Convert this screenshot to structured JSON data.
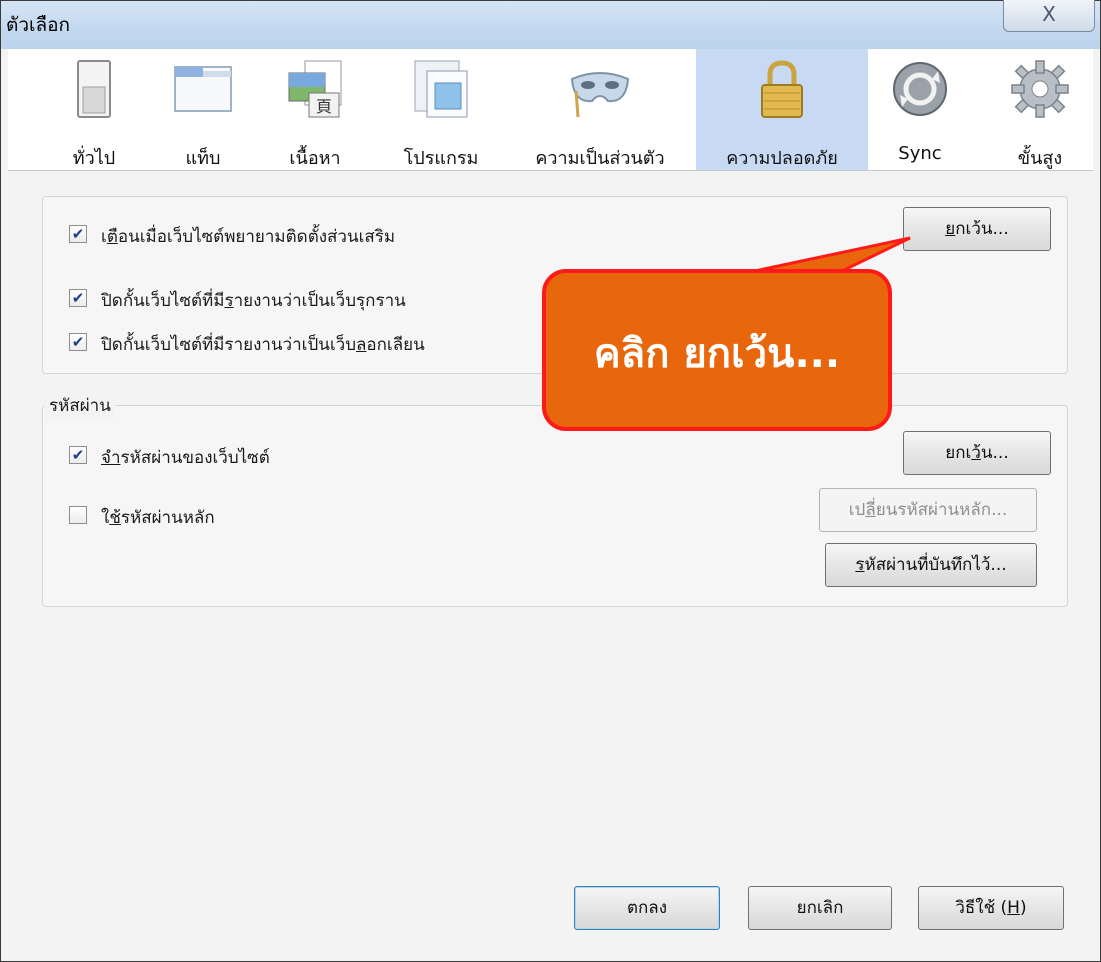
{
  "window": {
    "title": "ตัวเลือก",
    "close_glyph": "X"
  },
  "tabs": [
    {
      "label": "ทั่วไป",
      "icon": "switch-icon"
    },
    {
      "label": "แท็บ",
      "icon": "tab-window-icon"
    },
    {
      "label": "เนื้อหา",
      "icon": "content-image-icon"
    },
    {
      "label": "โปรแกรม",
      "icon": "applications-icon"
    },
    {
      "label": "ความเป็นส่วนตัว",
      "icon": "privacy-mask-icon"
    },
    {
      "label": "ความปลอดภัย",
      "icon": "padlock-icon",
      "active": true
    },
    {
      "label": "Sync",
      "icon": "sync-icon"
    },
    {
      "label": "ขั้นสูง",
      "icon": "gear-icon"
    }
  ],
  "security": {
    "warn_addons": {
      "label_pre": "เ",
      "label_ul": "ต",
      "label_post": "ือนเมื่อเว็บไซต์พยายามติดตั้งส่วนเสริม",
      "checked": true
    },
    "exceptions_btn_pre": "",
    "exceptions_btn_ul": "ย",
    "exceptions_btn_post": "กเว้น...",
    "block_attack": {
      "label_pre": "ปิดกั้นเว็บไซต์ที่มี",
      "label_ul": "ร",
      "label_post": "ายงานว่าเป็นเว็บรุกราน",
      "checked": true
    },
    "block_forgery": {
      "label_pre": "ปิดกั้นเว็บไซต์ที่มีรายงานว่าเป็นเว็บ",
      "label_ul": "ล",
      "label_post": "อกเลียน",
      "checked": true
    }
  },
  "passwords": {
    "legend": "รหัสผ่าน",
    "remember": {
      "label_pre": "",
      "label_ul": "จ",
      "label_post": "ำรหัสผ่านของเว็บไซต์",
      "checked": true
    },
    "exceptions_btn_pre": "ยกเ",
    "exceptions_btn_ul": "ว้",
    "exceptions_btn_post": "น...",
    "master": {
      "label_pre": "ใ",
      "label_ul": "ช้",
      "label_post": "รหัสผ่านหลัก",
      "checked": false
    },
    "change_master_pre": "เป",
    "change_master_ul": "ลี่",
    "change_master_post": "ยนรหัสผ่านหลัก...",
    "saved_pre": "",
    "saved_ul": "ร",
    "saved_post": "หัสผ่านที่บันทึกไว้..."
  },
  "footer": {
    "ok": "ตกลง",
    "cancel": "ยกเลิก",
    "help_pre": "วิธีใช้ (",
    "help_ul": "H",
    "help_post": ")"
  },
  "callout": {
    "text": "คลิก ยกเว้น..."
  },
  "colors": {
    "callout_fill": "#e8670c",
    "callout_border": "#ff1a1a",
    "active_tab": "#c8daf3"
  }
}
